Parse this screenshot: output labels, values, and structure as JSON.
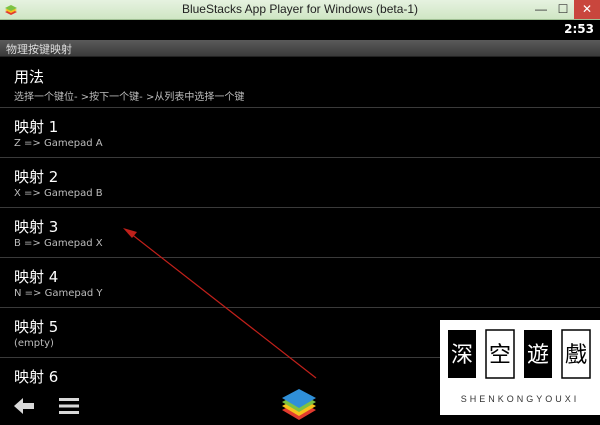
{
  "window": {
    "title": "BlueStacks App Player for Windows (beta-1)",
    "minimize_glyph": "—",
    "maximize_glyph": "☐",
    "close_glyph": "✕"
  },
  "statusbar": {
    "time": "2:53"
  },
  "activity": {
    "title": "物理按键映射"
  },
  "list": {
    "items": [
      {
        "title": "用法",
        "subtitle": "选择一个键位- >按下一个键- >从列表中选择一个键"
      },
      {
        "title": "映射 1",
        "subtitle": "Z => Gamepad A"
      },
      {
        "title": "映射 2",
        "subtitle": "X => Gamepad B"
      },
      {
        "title": "映射 3",
        "subtitle": "B => Gamepad X"
      },
      {
        "title": "映射 4",
        "subtitle": "N => Gamepad Y"
      },
      {
        "title": "映射 5",
        "subtitle": "(empty)"
      },
      {
        "title": "映射 6",
        "subtitle": ""
      }
    ]
  },
  "navbar": {
    "back_icon": "back-arrow-icon",
    "menu_icon": "menu-icon",
    "logo_icon": "bluestacks-logo-icon"
  },
  "watermark": {
    "characters": "深空遊戲",
    "text": "SHENKONGYOUXI"
  },
  "colors": {
    "annotation_arrow": "#c0201a",
    "titlebar": "#d8ebcf",
    "background": "#000000"
  }
}
